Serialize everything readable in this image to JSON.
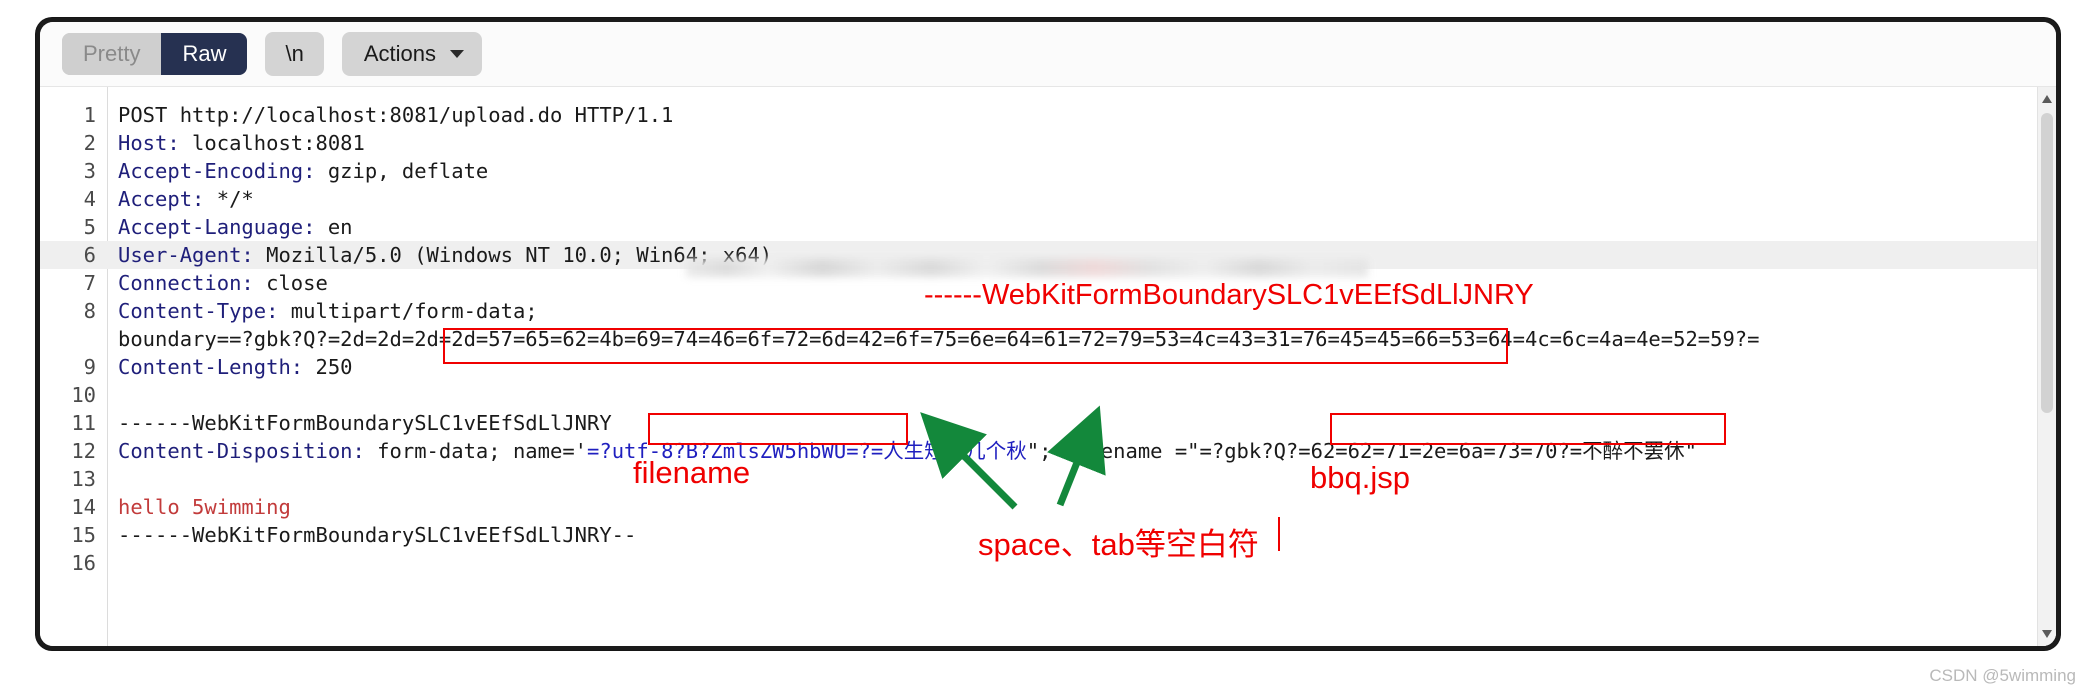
{
  "toolbar": {
    "pretty_label": "Pretty",
    "raw_label": "Raw",
    "newline_label": "\\n",
    "actions_label": "Actions"
  },
  "editor": {
    "lines": [
      {
        "no": "1",
        "segments": [
          {
            "t": "POST http://localhost:8081/upload.do HTTP/1.1",
            "c": "plain"
          }
        ]
      },
      {
        "no": "2",
        "segments": [
          {
            "t": "Host:",
            "c": "hdr"
          },
          {
            "t": " localhost:8081",
            "c": "plain"
          }
        ]
      },
      {
        "no": "3",
        "segments": [
          {
            "t": "Accept-Encoding:",
            "c": "hdr"
          },
          {
            "t": " gzip, deflate",
            "c": "plain"
          }
        ]
      },
      {
        "no": "4",
        "segments": [
          {
            "t": "Accept:",
            "c": "hdr"
          },
          {
            "t": " */*",
            "c": "plain"
          }
        ]
      },
      {
        "no": "5",
        "segments": [
          {
            "t": "Accept-Language:",
            "c": "hdr"
          },
          {
            "t": " en",
            "c": "plain"
          }
        ]
      },
      {
        "no": "6",
        "highlight": true,
        "segments": [
          {
            "t": "User-Agent:",
            "c": "hdr"
          },
          {
            "t": " Mozilla/5.0 (Windows NT 10.0; Win64; x64)",
            "c": "plain"
          }
        ]
      },
      {
        "no": "7",
        "segments": [
          {
            "t": "Connection:",
            "c": "hdr"
          },
          {
            "t": " close",
            "c": "plain"
          }
        ]
      },
      {
        "no": "8",
        "segments": [
          {
            "t": "Content-Type:",
            "c": "hdr"
          },
          {
            "t": " multipart/form-data;",
            "c": "plain"
          }
        ]
      },
      {
        "no": "",
        "wrap": true,
        "segments": [
          {
            "t": "boundary==?gbk?Q?=2d=2d=2d=2d=57=65=62=4b=69=74=46=6f=72=6d=42=6f=75=6e=64=61=72=79=53=4c=43=31=76=45=45=66=53=64=4c=6c=4a=4e=52=59?=",
            "c": "plain"
          }
        ]
      },
      {
        "no": "9",
        "segments": [
          {
            "t": "Content-Length:",
            "c": "hdr"
          },
          {
            "t": " 250",
            "c": "plain"
          }
        ]
      },
      {
        "no": "10",
        "segments": [
          {
            "t": "",
            "c": "plain"
          }
        ]
      },
      {
        "no": "11",
        "segments": [
          {
            "t": "------WebKitFormBoundarySLC1vEEfSdLlJNRY",
            "c": "plain"
          }
        ]
      },
      {
        "no": "12",
        "segments": [
          {
            "t": "Content-Disposition:",
            "c": "hdr"
          },
          {
            "t": " form-data; name='",
            "c": "plain"
          },
          {
            "t": "=?utf-8?B?ZmlsZW5hbWU=?=",
            "c": "blue"
          },
          {
            "t": "人生短短几个秋",
            "c": "blue"
          },
          {
            "t": "\"; filename =\"",
            "c": "plain"
          },
          {
            "t": "=?gbk?Q?=62=62=71=2e=6a=73=70?=",
            "c": "plain"
          },
          {
            "t": "不醉不罢休\"",
            "c": "plain"
          }
        ]
      },
      {
        "no": "13",
        "segments": [
          {
            "t": "",
            "c": "plain"
          }
        ]
      },
      {
        "no": "14",
        "segments": [
          {
            "t": "hello 5wimming",
            "c": "body"
          }
        ]
      },
      {
        "no": "15",
        "segments": [
          {
            "t": "------WebKitFormBoundarySLC1vEEfSdLlJNRY--",
            "c": "plain"
          }
        ]
      },
      {
        "no": "16",
        "segments": [
          {
            "t": "",
            "c": "plain"
          }
        ]
      }
    ]
  },
  "annotations": {
    "boundary_text": "------WebKitFormBoundarySLC1vEEfSdLlJNRY",
    "filename_text": "filename",
    "bbq_text": "bbq.jsp",
    "whitespace_text": "space、tab等空白符"
  },
  "colors": {
    "annotation_red": "#ef0000",
    "arrow_green": "#13883b",
    "header_blue": "#1f1f7a",
    "value_blue": "#1f1fbf",
    "body_red": "#c23b3b",
    "active_tab": "#263151"
  },
  "watermark": {
    "text": "CSDN @5wimming"
  }
}
